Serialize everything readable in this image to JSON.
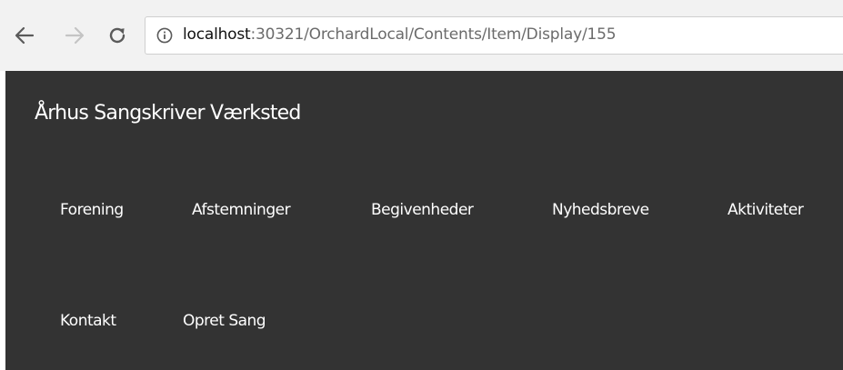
{
  "browser": {
    "url_host": "localhost",
    "url_rest": ":30321/OrchardLocal/Contents/Item/Display/155",
    "icons": [
      "back-arrow-icon",
      "forward-arrow-icon",
      "reload-icon",
      "info-icon"
    ]
  },
  "site": {
    "title": "Århus Sangskriver Værksted",
    "nav": {
      "forening": "Forening",
      "afstemninger": "Afstemninger",
      "begivenheder": "Begivenheder",
      "nyhedsbreve": "Nyhedsbreve",
      "aktiviteter": "Aktiviteter",
      "kontakt": "Kontakt",
      "opret_sang": "Opret Sang"
    }
  },
  "colors": {
    "chrome_bg": "#f2f2f2",
    "header_bg": "#333333",
    "text_light": "#ffffff"
  }
}
